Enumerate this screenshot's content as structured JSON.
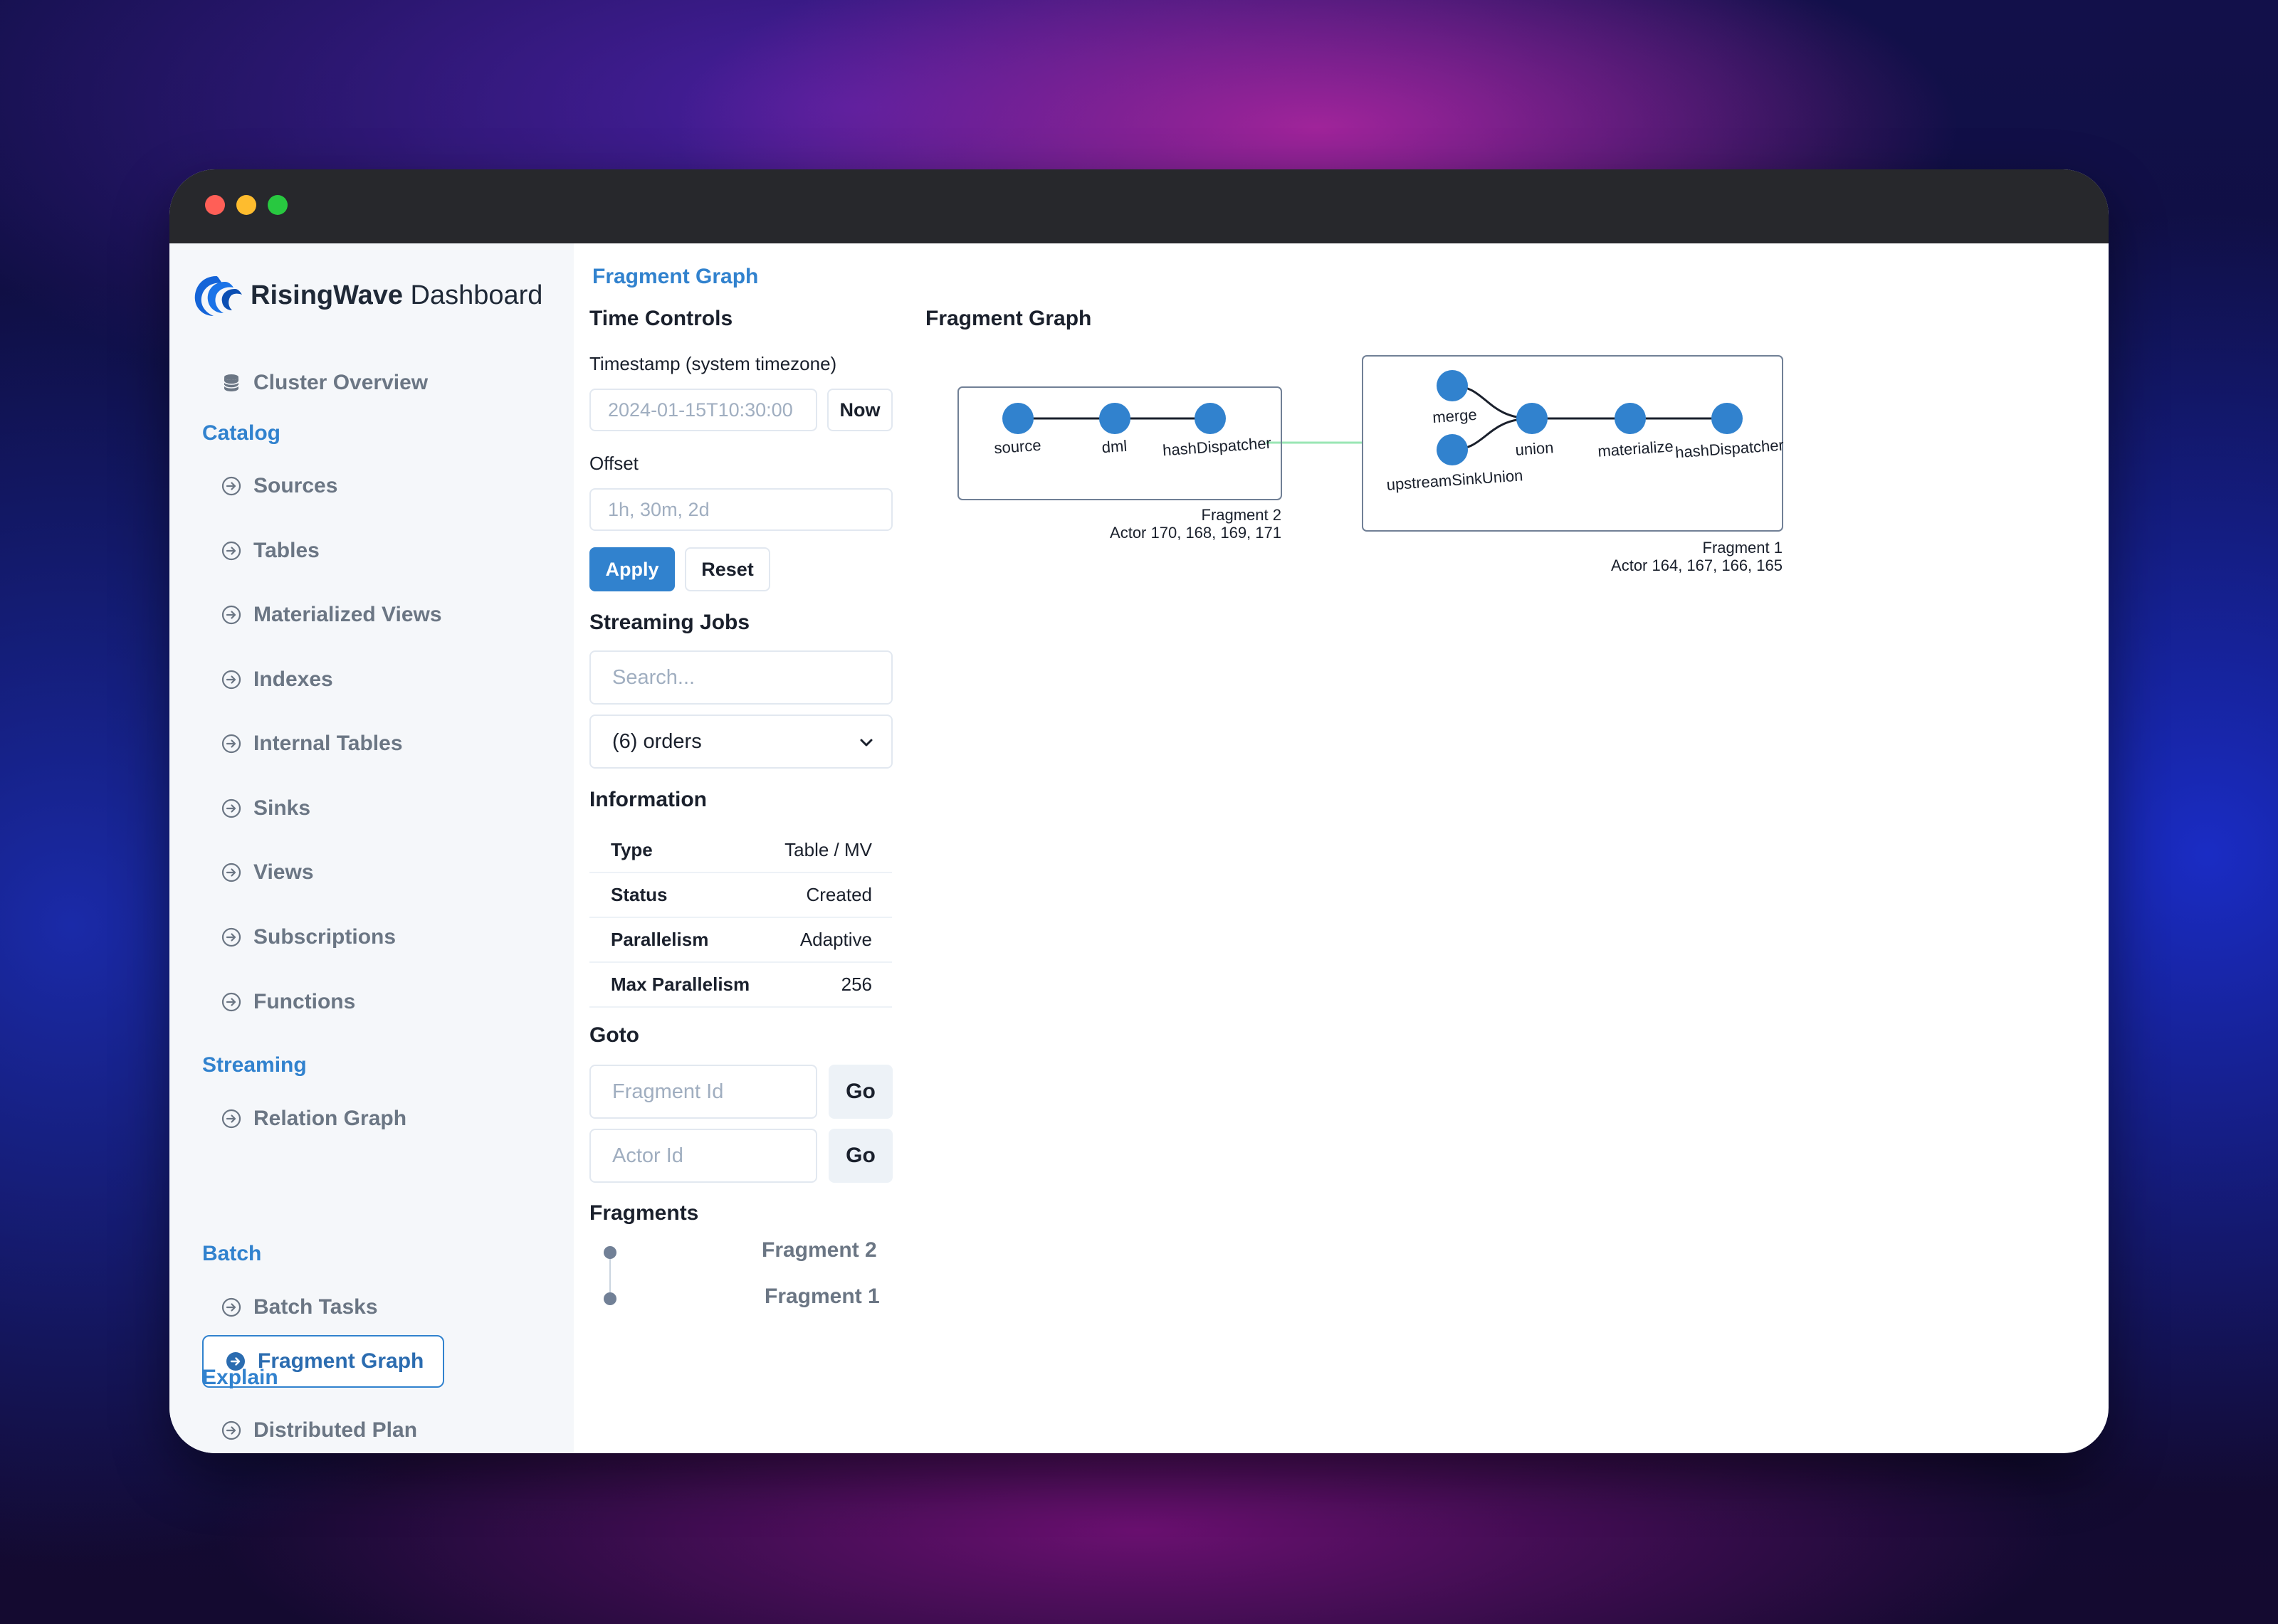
{
  "app": {
    "brand_bold": "RisingWave",
    "brand_light": " Dashboard"
  },
  "sidebar": {
    "cluster_overview": "Cluster Overview",
    "sections": {
      "catalog": "Catalog",
      "streaming": "Streaming",
      "batch": "Batch",
      "explain": "Explain"
    },
    "catalog_items": [
      "Sources",
      "Tables",
      "Materialized Views",
      "Indexes",
      "Internal Tables",
      "Sinks",
      "Views",
      "Subscriptions",
      "Functions"
    ],
    "streaming_items": [
      "Relation Graph",
      "Fragment Graph"
    ],
    "active_item": "Fragment Graph",
    "batch_items": [
      "Batch Tasks"
    ],
    "explain_items": [
      "Distributed Plan"
    ]
  },
  "main": {
    "page_title": "Fragment Graph",
    "time_controls": {
      "heading": "Time Controls",
      "timestamp_label": "Timestamp (system timezone)",
      "timestamp_value": "2024-01-15T10:30:00",
      "now_label": "Now",
      "offset_label": "Offset",
      "offset_placeholder": "1h, 30m, 2d",
      "apply_label": "Apply",
      "reset_label": "Reset"
    },
    "streaming_jobs": {
      "heading": "Streaming Jobs",
      "search_placeholder": "Search...",
      "selected_job": "(6) orders"
    },
    "information": {
      "heading": "Information",
      "rows": [
        {
          "key": "Type",
          "value": "Table / MV"
        },
        {
          "key": "Status",
          "value": "Created"
        },
        {
          "key": "Parallelism",
          "value": "Adaptive"
        },
        {
          "key": "Max Parallelism",
          "value": "256"
        }
      ]
    },
    "goto": {
      "heading": "Goto",
      "fragment_placeholder": "Fragment Id",
      "actor_placeholder": "Actor Id",
      "go_label": "Go"
    },
    "fragments": {
      "heading": "Fragments",
      "items": [
        "Fragment 2",
        "Fragment 1"
      ]
    }
  },
  "graph": {
    "title": "Fragment Graph",
    "fragments": [
      {
        "name": "Fragment 2",
        "actors": "Actor 170, 168, 169, 171",
        "nodes": [
          "source",
          "dml",
          "hashDispatcher"
        ]
      },
      {
        "name": "Fragment 1",
        "actors": "Actor 164, 167, 166, 165",
        "nodes": [
          "merge",
          "upstreamSinkUnion",
          "union",
          "materialize",
          "hashDispatcher"
        ]
      }
    ],
    "colors": {
      "node": "#3182ce",
      "edge": "#1a202c",
      "fragment_edge": "#9ae6b4",
      "accent": "#3182ce"
    }
  }
}
